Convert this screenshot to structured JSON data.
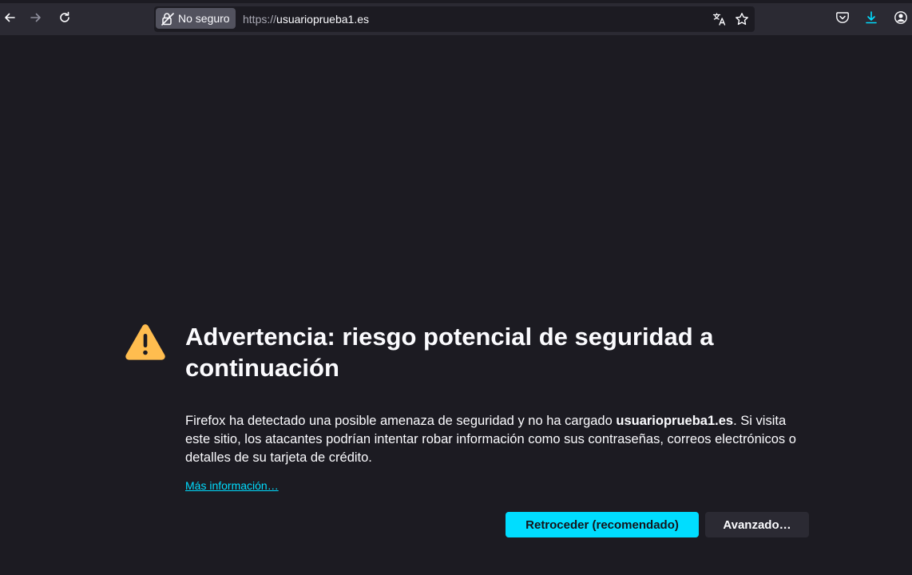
{
  "toolbar": {
    "back_icon": "arrow-left-icon",
    "forward_icon": "arrow-right-icon",
    "reload_icon": "reload-icon",
    "security_label": "No seguro",
    "url_scheme": "https://",
    "url_host": "usuarioprueba1.es",
    "translate_icon": "translate-icon",
    "bookmark_icon": "star-icon",
    "pocket_icon": "pocket-icon",
    "download_icon": "download-icon",
    "account_icon": "account-icon"
  },
  "error_page": {
    "title": "Advertencia: riesgo potencial de seguridad a continuación",
    "desc_before": "Firefox ha detectado una posible amenaza de seguridad y no ha cargado ",
    "desc_host": "usuarioprueba1.es",
    "desc_after": ". Si visita este sitio, los atacantes podrían intentar robar información como sus contraseñas, correos electrónicos o detalles de su tarjeta de crédito.",
    "more_info": "Más información…",
    "back_button": "Retroceder (recomendado)",
    "advanced_button": "Avanzado…"
  },
  "colors": {
    "background": "#1c1b22",
    "toolbar": "#2b2a33",
    "accent": "#00ddff",
    "warning": "#ffbd4f"
  }
}
